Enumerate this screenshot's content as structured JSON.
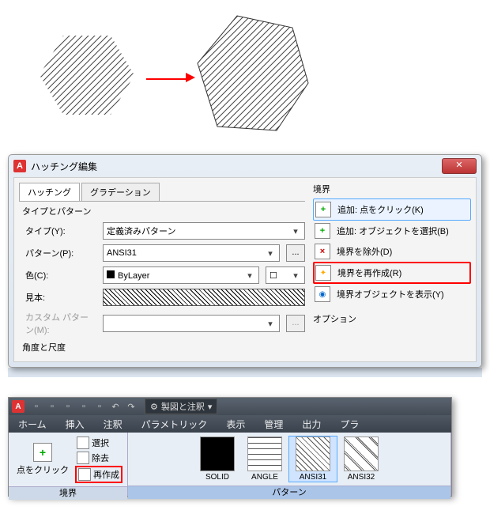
{
  "dialog": {
    "title": "ハッチング編集",
    "tabs": {
      "hatch": "ハッチング",
      "grad": "グラデーション"
    },
    "group1": "タイプとパターン",
    "type_label": "タイプ(Y):",
    "type_value": "定義済みパターン",
    "pattern_label": "パターン(P):",
    "pattern_value": "ANSI31",
    "color_label": "色(C):",
    "color_value": "ByLayer",
    "sample_label": "見本:",
    "custom_label": "カスタム パターン(M):",
    "group2": "角度と尺度"
  },
  "boundary": {
    "title": "境界",
    "items": [
      "追加: 点をクリック(K)",
      "追加: オブジェクトを選択(B)",
      "境界を除外(D)",
      "境界を再作成(R)",
      "境界オブジェクトを表示(Y)"
    ],
    "options": "オプション"
  },
  "ribbon": {
    "workspace": "製図と注釈",
    "tabs": [
      "ホーム",
      "挿入",
      "注釈",
      "パラメトリック",
      "表示",
      "管理",
      "出力",
      "プラ"
    ],
    "pick_label": "点をクリック",
    "mini": {
      "select": "選択",
      "remove": "除去",
      "recreate": "再作成"
    },
    "panel_boundary": "境界",
    "panel_pattern": "パターン",
    "patterns": {
      "solid": "SOLID",
      "angle": "ANGLE",
      "ansi31": "ANSI31",
      "ansi32": "ANSI32"
    }
  }
}
